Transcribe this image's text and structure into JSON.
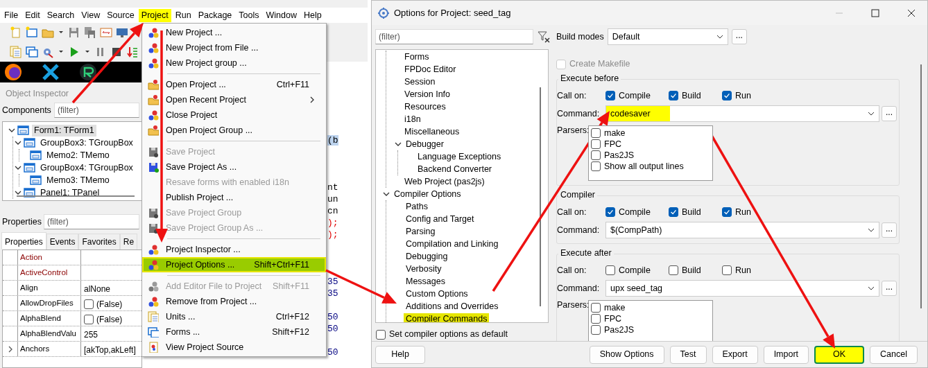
{
  "ide": {
    "menubar": [
      {
        "label": "File",
        "highlighted": false
      },
      {
        "label": "Edit",
        "highlighted": false
      },
      {
        "label": "Search",
        "highlighted": false
      },
      {
        "label": "View",
        "highlighted": false
      },
      {
        "label": "Source",
        "highlighted": false
      },
      {
        "label": "Project",
        "highlighted": true
      },
      {
        "label": "Run",
        "highlighted": false
      },
      {
        "label": "Package",
        "highlighted": false
      },
      {
        "label": "Tools",
        "highlighted": false
      },
      {
        "label": "Window",
        "highlighted": false
      },
      {
        "label": "Help",
        "highlighted": false
      }
    ],
    "object_inspector": {
      "title": "Object Inspector",
      "components_label": "Components",
      "components_filter": {
        "placeholder": "(filter)"
      },
      "components": [
        {
          "label": "Form1: TForm1",
          "selected": true,
          "expanded": true,
          "children": [
            {
              "label": "GroupBox3: TGroupBox",
              "selected": false,
              "expanded": true,
              "children": [
                {
                  "label": "Memo2: TMemo",
                  "selected": false
                }
              ]
            },
            {
              "label": "GroupBox4: TGroupBox",
              "selected": false,
              "expanded": true,
              "children": [
                {
                  "label": "Memo3: TMemo",
                  "selected": false
                }
              ]
            },
            {
              "label": "Panel1: TPanel",
              "selected": false,
              "expanded": true
            }
          ]
        }
      ],
      "properties_label": "Properties",
      "properties_filter": {
        "placeholder": "(filter)"
      },
      "tabs": [
        {
          "label": "Properties",
          "selected": true
        },
        {
          "label": "Events",
          "selected": false
        },
        {
          "label": "Favorites",
          "selected": false
        },
        {
          "label": "Re",
          "selected": false
        }
      ],
      "properties": [
        {
          "name": "Action",
          "kind": "reference"
        },
        {
          "name": "ActiveControl",
          "kind": "reference"
        },
        {
          "name": "Align",
          "value": "alNone",
          "kind": "text"
        },
        {
          "name": "AllowDropFiles",
          "value": "(False)",
          "kind": "checkbox",
          "checked": false
        },
        {
          "name": "AlphaBlend",
          "value": "(False)",
          "kind": "checkbox",
          "checked": false
        },
        {
          "name": "AlphaBlendValu",
          "value": "255",
          "kind": "text"
        },
        {
          "name": "Anchors",
          "value": "[akTop,akLeft]",
          "kind": "text",
          "expanded": false
        }
      ]
    },
    "editor_fragments": [
      {
        "text": "(b",
        "kind": "selected"
      },
      {
        "text": "nt",
        "kind": "code"
      },
      {
        "text": "un",
        "kind": "code"
      },
      {
        "text": "cn",
        "kind": "code"
      },
      {
        "text": ");",
        "kind": "error"
      },
      {
        "text": ");",
        "kind": "error"
      },
      {
        "text": "35",
        "kind": "number"
      },
      {
        "text": "35",
        "kind": "number"
      },
      {
        "text": "50",
        "kind": "number"
      },
      {
        "text": "50",
        "kind": "number"
      },
      {
        "text": "50",
        "kind": "number"
      }
    ],
    "project_menu": [
      {
        "kind": "item",
        "label": "New Project ...",
        "disabled": false,
        "selected": false,
        "submenu": false
      },
      {
        "kind": "item",
        "label": "New Project from File ...",
        "disabled": false,
        "selected": false,
        "submenu": false
      },
      {
        "kind": "item",
        "label": "New Project group ...",
        "disabled": false,
        "selected": false,
        "submenu": false
      },
      {
        "kind": "separator"
      },
      {
        "kind": "item",
        "label": "Open Project ...",
        "shortcut": "Ctrl+F11",
        "disabled": false,
        "selected": false,
        "submenu": false
      },
      {
        "kind": "item",
        "label": "Open Recent Project",
        "disabled": false,
        "selected": false,
        "submenu": true
      },
      {
        "kind": "item",
        "label": "Close Project",
        "disabled": false,
        "selected": false,
        "submenu": false
      },
      {
        "kind": "item",
        "label": "Open Project Group ...",
        "disabled": false,
        "selected": false,
        "submenu": false
      },
      {
        "kind": "separator"
      },
      {
        "kind": "item",
        "label": "Save Project",
        "disabled": true,
        "selected": false,
        "submenu": false
      },
      {
        "kind": "item",
        "label": "Save Project As ...",
        "disabled": false,
        "selected": false,
        "submenu": false
      },
      {
        "kind": "item",
        "label": "Resave forms with enabled i18n",
        "disabled": true,
        "selected": false,
        "submenu": false
      },
      {
        "kind": "item",
        "label": "Publish Project ...",
        "disabled": false,
        "selected": false,
        "submenu": false
      },
      {
        "kind": "item",
        "label": "Save Project Group",
        "disabled": true,
        "selected": false,
        "submenu": false
      },
      {
        "kind": "item",
        "label": "Save Project Group As ...",
        "disabled": true,
        "selected": false,
        "submenu": false
      },
      {
        "kind": "separator"
      },
      {
        "kind": "item",
        "label": "Project Inspector ...",
        "disabled": false,
        "selected": false,
        "submenu": false
      },
      {
        "kind": "item",
        "label": "Project Options ...",
        "shortcut": "Shift+Ctrl+F11",
        "disabled": false,
        "selected": true,
        "submenu": false
      },
      {
        "kind": "separator"
      },
      {
        "kind": "item",
        "label": "Add Editor File to Project",
        "shortcut": "Shift+F11",
        "disabled": true,
        "selected": false,
        "submenu": false
      },
      {
        "kind": "item",
        "label": "Remove from Project ...",
        "disabled": false,
        "selected": false,
        "submenu": false
      },
      {
        "kind": "item",
        "label": "Units ...",
        "shortcut": "Ctrl+F12",
        "disabled": false,
        "selected": false,
        "submenu": false
      },
      {
        "kind": "item",
        "label": "Forms ...",
        "shortcut": "Shift+F12",
        "disabled": false,
        "selected": false,
        "submenu": false
      },
      {
        "kind": "item",
        "label": "View Project Source",
        "disabled": false,
        "selected": false,
        "submenu": false
      }
    ]
  },
  "dialog": {
    "title": "Options for Project: seed_tag",
    "filter": {
      "placeholder": "(filter)"
    },
    "tree": {
      "continued_items": [
        {
          "label": "Forms",
          "selected": false
        },
        {
          "label": "FPDoc Editor",
          "selected": false
        },
        {
          "label": "Session",
          "selected": false
        },
        {
          "label": "Version Info",
          "selected": false
        },
        {
          "label": "Resources",
          "selected": false
        },
        {
          "label": "i18n",
          "selected": false
        },
        {
          "label": "Miscellaneous",
          "selected": false
        },
        {
          "label": "Debugger",
          "selected": false,
          "expanded": true,
          "children": [
            {
              "label": "Language Exceptions",
              "selected": false
            },
            {
              "label": "Backend Converter",
              "selected": false
            }
          ]
        },
        {
          "label": "Web Project (pas2js)",
          "selected": false
        }
      ],
      "items": [
        {
          "label": "Compiler Options",
          "selected": false,
          "expanded": true,
          "children": [
            {
              "label": "Paths",
              "selected": false
            },
            {
              "label": "Config and Target",
              "selected": false
            },
            {
              "label": "Parsing",
              "selected": false
            },
            {
              "label": "Compilation and Linking",
              "selected": false
            },
            {
              "label": "Debugging",
              "selected": false
            },
            {
              "label": "Verbosity",
              "selected": false
            },
            {
              "label": "Messages",
              "selected": false
            },
            {
              "label": "Custom Options",
              "selected": false
            },
            {
              "label": "Additions and Overrides",
              "selected": false
            },
            {
              "label": "Compiler Commands",
              "selected": true
            }
          ]
        }
      ]
    },
    "default_checkbox": {
      "label": "Set compiler options as default",
      "checked": false
    },
    "build_modes": {
      "label": "Build modes",
      "value": "Default",
      "more": "..."
    },
    "create_makefile": {
      "label": "Create Makefile",
      "checked": false,
      "disabled": true
    },
    "groups": [
      {
        "title": "Execute before",
        "call_on_label": "Call on:",
        "call_on": [
          {
            "label": "Compile",
            "checked": true
          },
          {
            "label": "Build",
            "checked": true
          },
          {
            "label": "Run",
            "checked": true
          }
        ],
        "command_label": "Command:",
        "command": "codesaver",
        "command_highlighted": true,
        "more": "...",
        "parsers_label": "Parsers:",
        "parsers": [
          {
            "label": "make",
            "checked": false
          },
          {
            "label": "FPC",
            "checked": false
          },
          {
            "label": "Pas2JS",
            "checked": false
          },
          {
            "label": "Show all output lines",
            "checked": false
          }
        ]
      },
      {
        "title": "Compiler",
        "call_on_label": "Call on:",
        "call_on": [
          {
            "label": "Compile",
            "checked": true
          },
          {
            "label": "Build",
            "checked": true
          },
          {
            "label": "Run",
            "checked": true
          }
        ],
        "command_label": "Command:",
        "command": "$(CompPath)",
        "command_highlighted": false,
        "more": "..."
      },
      {
        "title": "Execute after",
        "call_on_label": "Call on:",
        "call_on": [
          {
            "label": "Compile",
            "checked": false
          },
          {
            "label": "Build",
            "checked": false
          },
          {
            "label": "Run",
            "checked": false
          }
        ],
        "command_label": "Command:",
        "command": "upx seed_tag",
        "command_highlighted": false,
        "more": "...",
        "parsers_label": "Parsers:",
        "parsers": [
          {
            "label": "make",
            "checked": false
          },
          {
            "label": "FPC",
            "checked": false
          },
          {
            "label": "Pas2JS",
            "checked": false
          }
        ]
      }
    ],
    "left_buttons": [
      {
        "label": "Help",
        "highlighted": false
      }
    ],
    "buttons": [
      {
        "label": "Show Options",
        "highlighted": false
      },
      {
        "label": "Test",
        "highlighted": false
      },
      {
        "label": "Export",
        "highlighted": false
      },
      {
        "label": "Import",
        "highlighted": false
      },
      {
        "label": "OK",
        "highlighted": true
      },
      {
        "label": "Cancel",
        "highlighted": false
      }
    ]
  }
}
